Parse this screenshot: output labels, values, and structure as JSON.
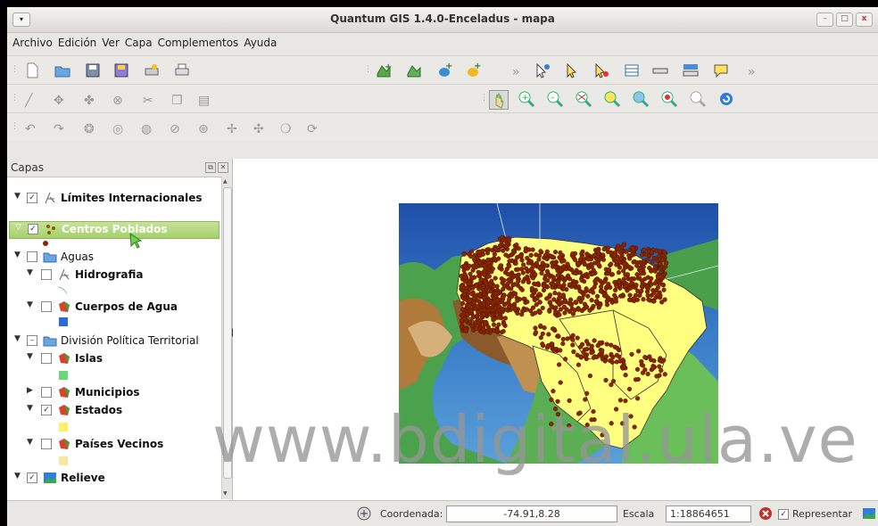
{
  "window": {
    "title": "Quantum GIS 1.4.0-Enceladus - mapa",
    "controls": {
      "minimize": "–",
      "maximize": "□",
      "close": "x"
    }
  },
  "menu": [
    "Archivo",
    "Edición",
    "Ver",
    "Capa",
    "Complementos",
    "Ayuda"
  ],
  "layers_panel": {
    "title": "Capas",
    "layers": [
      {
        "label": "Límites Internacionales",
        "checked": true,
        "bold": true
      },
      {
        "label": "Centros Poblados",
        "checked": true,
        "bold": true,
        "selected": true
      },
      {
        "label": "Aguas",
        "checked": false,
        "bold": false
      },
      {
        "label": "Hidrografia",
        "checked": false,
        "bold": true
      },
      {
        "label": "Cuerpos de Agua",
        "checked": false,
        "bold": true
      },
      {
        "label": "División Política Territorial",
        "checked": "partial",
        "bold": false
      },
      {
        "label": "Islas",
        "checked": false,
        "bold": true
      },
      {
        "label": "Municipios",
        "checked": false,
        "bold": true
      },
      {
        "label": "Estados",
        "checked": true,
        "bold": true
      },
      {
        "label": "Países Vecinos",
        "checked": false,
        "bold": true
      },
      {
        "label": "Relieve",
        "checked": true,
        "bold": true
      }
    ]
  },
  "statusbar": {
    "coord_label": "Coordenada:",
    "coord_value": "-74.91,8.28",
    "scale_label": "Escala",
    "scale_value": "1:18864651",
    "render_label": "Representar"
  },
  "watermark": "www.bdigital.ula.ve",
  "colors": {
    "states_fill": "#ffff80",
    "points": "#8b2500",
    "selection": "#a6d06b"
  },
  "icons": [
    "new-project-icon",
    "open-project-icon",
    "save-project-icon",
    "save-as-icon",
    "print-composer-icon",
    "print-icon",
    "add-vector-icon",
    "add-raster-icon",
    "add-postgis-icon",
    "new-layer-icon",
    "identify-icon",
    "select-icon",
    "deselect-icon",
    "attribute-table-icon",
    "measure-icon",
    "measure-area-icon",
    "map-tips-icon",
    "pan-icon",
    "zoom-in-icon",
    "zoom-out-icon",
    "zoom-full-icon",
    "zoom-selection-icon",
    "zoom-layer-icon",
    "zoom-last-icon",
    "zoom-actual-icon",
    "refresh-icon"
  ]
}
